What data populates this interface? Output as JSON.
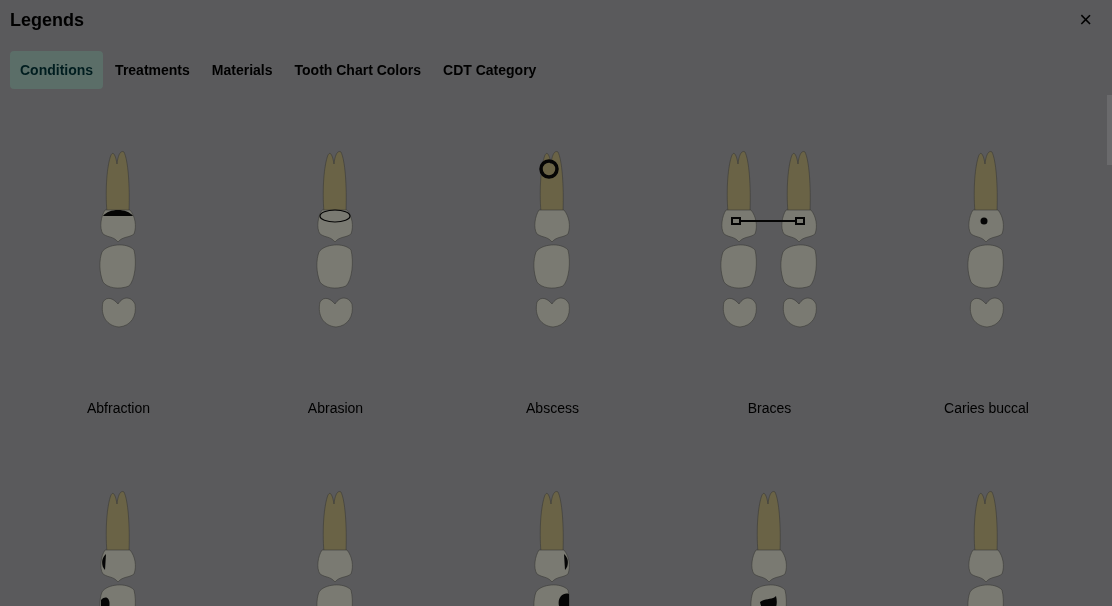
{
  "dialog": {
    "title": "Legends",
    "close": "×"
  },
  "tabs": [
    {
      "label": "Conditions",
      "selected": true
    },
    {
      "label": "Treatments",
      "selected": false
    },
    {
      "label": "Materials",
      "selected": false
    },
    {
      "label": "Tooth Chart Colors",
      "selected": false
    },
    {
      "label": "CDT Category",
      "selected": false
    }
  ],
  "items": [
    {
      "label": "Abfraction",
      "kind": "abfraction"
    },
    {
      "label": "Abrasion",
      "kind": "abrasion"
    },
    {
      "label": "Abscess",
      "kind": "abscess"
    },
    {
      "label": "Braces",
      "kind": "braces"
    },
    {
      "label": "Caries buccal",
      "kind": "dot"
    },
    {
      "kind": "cervicalleft"
    },
    {
      "kind": "plain"
    },
    {
      "kind": "cervicalright"
    },
    {
      "kind": "occlusal"
    },
    {
      "kind": "plain"
    }
  ]
}
